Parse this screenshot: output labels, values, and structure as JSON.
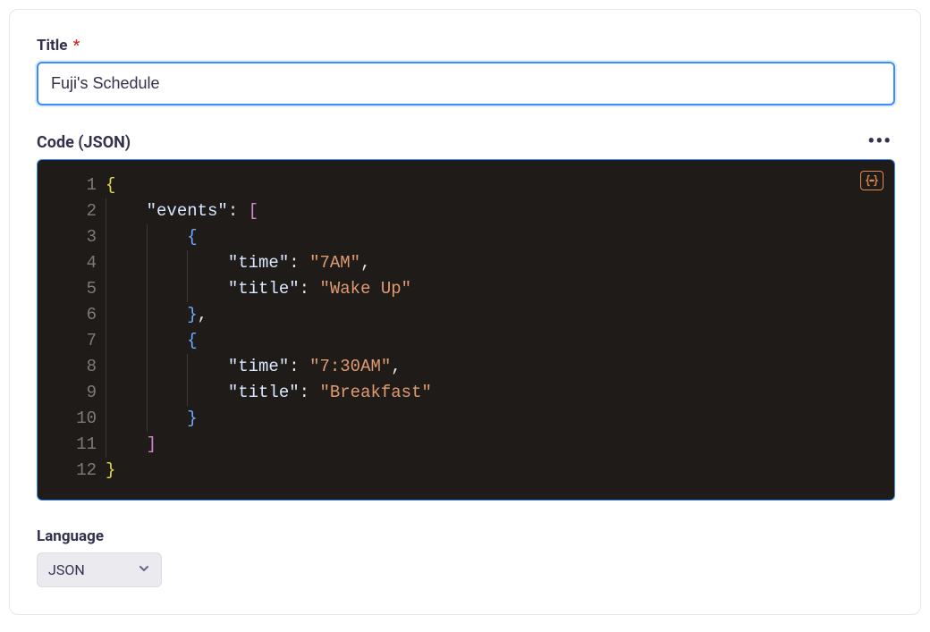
{
  "title": {
    "label": "Title",
    "required_marker": "*",
    "value": "Fuji's Schedule"
  },
  "code": {
    "label": "Code (JSON)",
    "more_button_name": "more-options",
    "format_button_name": "format-json",
    "lines": [
      "{",
      "    \"events\": [",
      "        {",
      "            \"time\": \"7AM\",",
      "            \"title\": \"Wake Up\"",
      "        },",
      "        {",
      "            \"time\": \"7:30AM\",",
      "            \"title\": \"Breakfast\"",
      "        }",
      "    ]",
      "}"
    ],
    "parsed": {
      "events": [
        {
          "time": "7AM",
          "title": "Wake Up"
        },
        {
          "time": "7:30AM",
          "title": "Breakfast"
        }
      ]
    }
  },
  "language": {
    "label": "Language",
    "selected": "JSON"
  }
}
